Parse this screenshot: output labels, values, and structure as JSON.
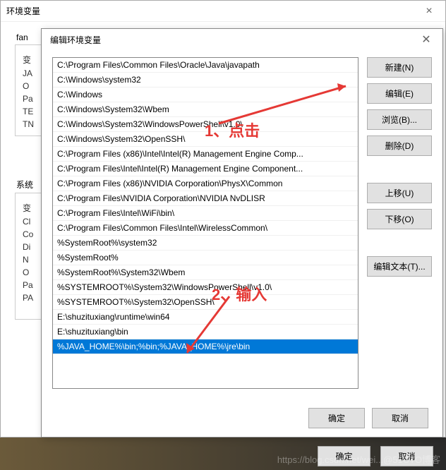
{
  "outer": {
    "title": "环境变量",
    "user_group_label": "fan",
    "sys_group_label": "系统",
    "user_rows": [
      "变",
      "JA",
      "O",
      "Pa",
      "TE",
      "TN"
    ],
    "sys_rows": [
      "变",
      "Cl",
      "Co",
      "Di",
      "N",
      "O",
      "Pa",
      "PA"
    ],
    "ok_label": "确定",
    "cancel_label": "取消"
  },
  "inner": {
    "title": "编辑环境变量",
    "list": [
      "C:\\Program Files\\Common Files\\Oracle\\Java\\javapath",
      "C:\\Windows\\system32",
      "C:\\Windows",
      "C:\\Windows\\System32\\Wbem",
      "C:\\Windows\\System32\\WindowsPowerShell\\v1.0\\",
      "C:\\Windows\\System32\\OpenSSH\\",
      "C:\\Program Files (x86)\\Intel\\Intel(R) Management Engine Comp...",
      "C:\\Program Files\\Intel\\Intel(R) Management Engine Component...",
      "C:\\Program Files (x86)\\NVIDIA Corporation\\PhysX\\Common",
      "C:\\Program Files\\NVIDIA Corporation\\NVIDIA NvDLISR",
      "C:\\Program Files\\Intel\\WiFi\\bin\\",
      "C:\\Program Files\\Common Files\\Intel\\WirelessCommon\\",
      "%SystemRoot%\\system32",
      "%SystemRoot%",
      "%SystemRoot%\\System32\\Wbem",
      "%SYSTEMROOT%\\System32\\WindowsPowerShell\\v1.0\\",
      "%SYSTEMROOT%\\System32\\OpenSSH\\",
      "E:\\shuzituxiang\\runtime\\win64",
      "E:\\shuzituxiang\\bin",
      "%JAVA_HOME%\\bin;%bin;%JAVA_HOME%\\jre\\bin"
    ],
    "selected_index": 19,
    "buttons": {
      "new": "新建(N)",
      "edit": "编辑(E)",
      "browse": "浏览(B)...",
      "delete": "删除(D)",
      "up": "上移(U)",
      "down": "下移(O)",
      "edit_text": "编辑文本(T)..."
    },
    "ok_label": "确定",
    "cancel_label": "取消"
  },
  "annotations": {
    "a1": "1、点击",
    "a2": "2、输入"
  },
  "watermark": "https://blog.csdn.net/wei...@51CTO博客"
}
